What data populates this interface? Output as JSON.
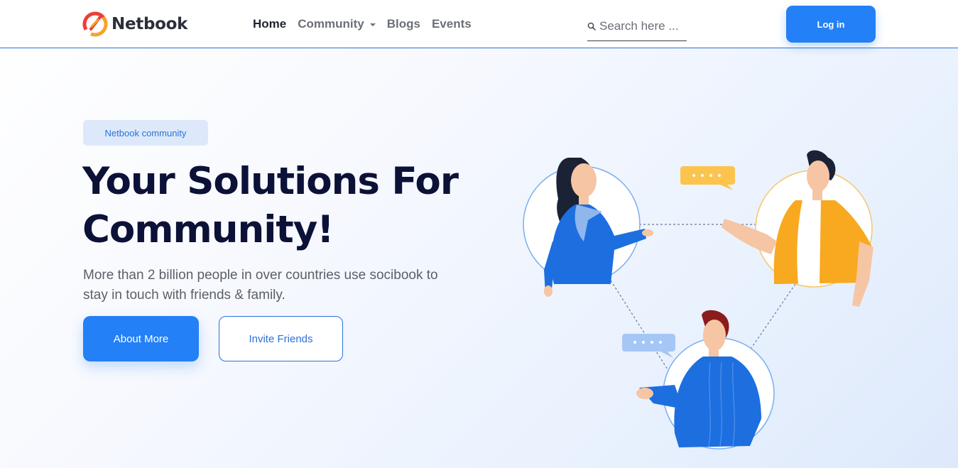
{
  "brand": {
    "name": "Netbook",
    "colors": {
      "accent": "#2380f6",
      "logo_red": "#ee3d3a",
      "logo_orange": "#f7a427",
      "heading": "#0c1137"
    }
  },
  "nav": {
    "items": [
      {
        "label": "Home",
        "active": true
      },
      {
        "label": "Community",
        "has_dropdown": true
      },
      {
        "label": "Blogs"
      },
      {
        "label": "Events"
      }
    ]
  },
  "search": {
    "placeholder": "Search here ..."
  },
  "header": {
    "login_label": "Log in"
  },
  "hero": {
    "badge": "Netbook community",
    "title": "Your Solutions For Community!",
    "description": "More than 2 billion people in over countries use socibook to stay in touch with friends & family.",
    "primary_button": "About More",
    "secondary_button": "Invite Friends"
  }
}
